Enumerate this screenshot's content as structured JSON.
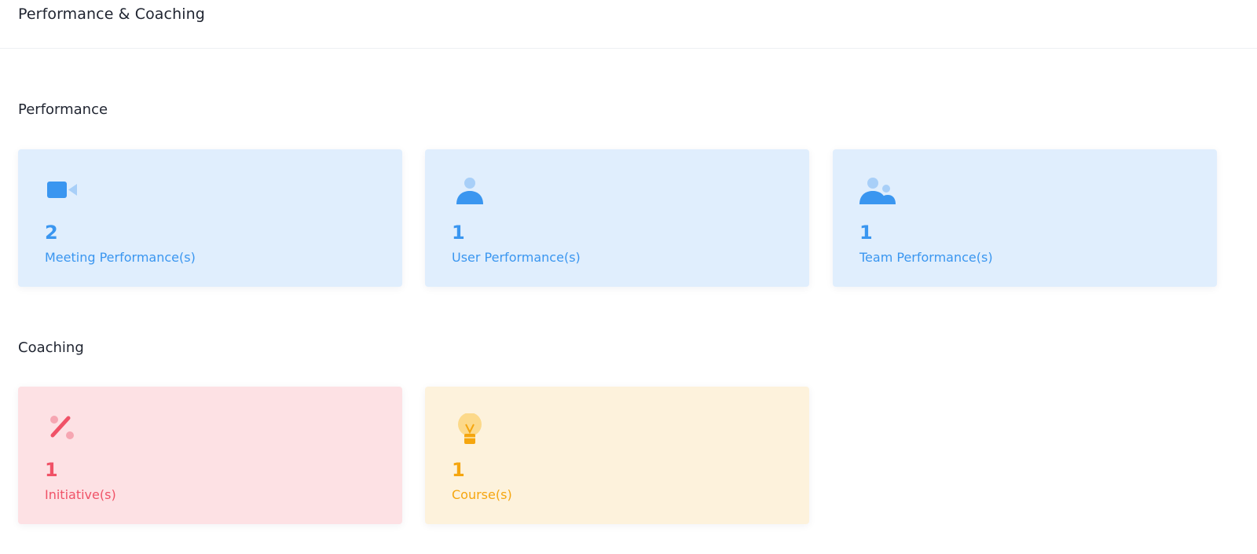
{
  "header": {
    "title": "Performance & Coaching"
  },
  "performance": {
    "title": "Performance",
    "cards": [
      {
        "count": "2",
        "label": "Meeting Performance(s)",
        "icon": "video-camera-icon"
      },
      {
        "count": "1",
        "label": "User Performance(s)",
        "icon": "user-icon"
      },
      {
        "count": "1",
        "label": "Team Performance(s)",
        "icon": "team-icon"
      }
    ]
  },
  "coaching": {
    "title": "Coaching",
    "cards": [
      {
        "count": "1",
        "label": "Initiative(s)",
        "icon": "percent-icon"
      },
      {
        "count": "1",
        "label": "Course(s)",
        "icon": "lightbulb-icon"
      }
    ]
  },
  "colors": {
    "blue_accent": "#3a96f0",
    "blue_bg": "#e0eefd",
    "red_accent": "#f05267",
    "red_bg": "#fde1e4",
    "yellow_accent": "#f5a60f",
    "yellow_bg": "#fdf2dc"
  }
}
